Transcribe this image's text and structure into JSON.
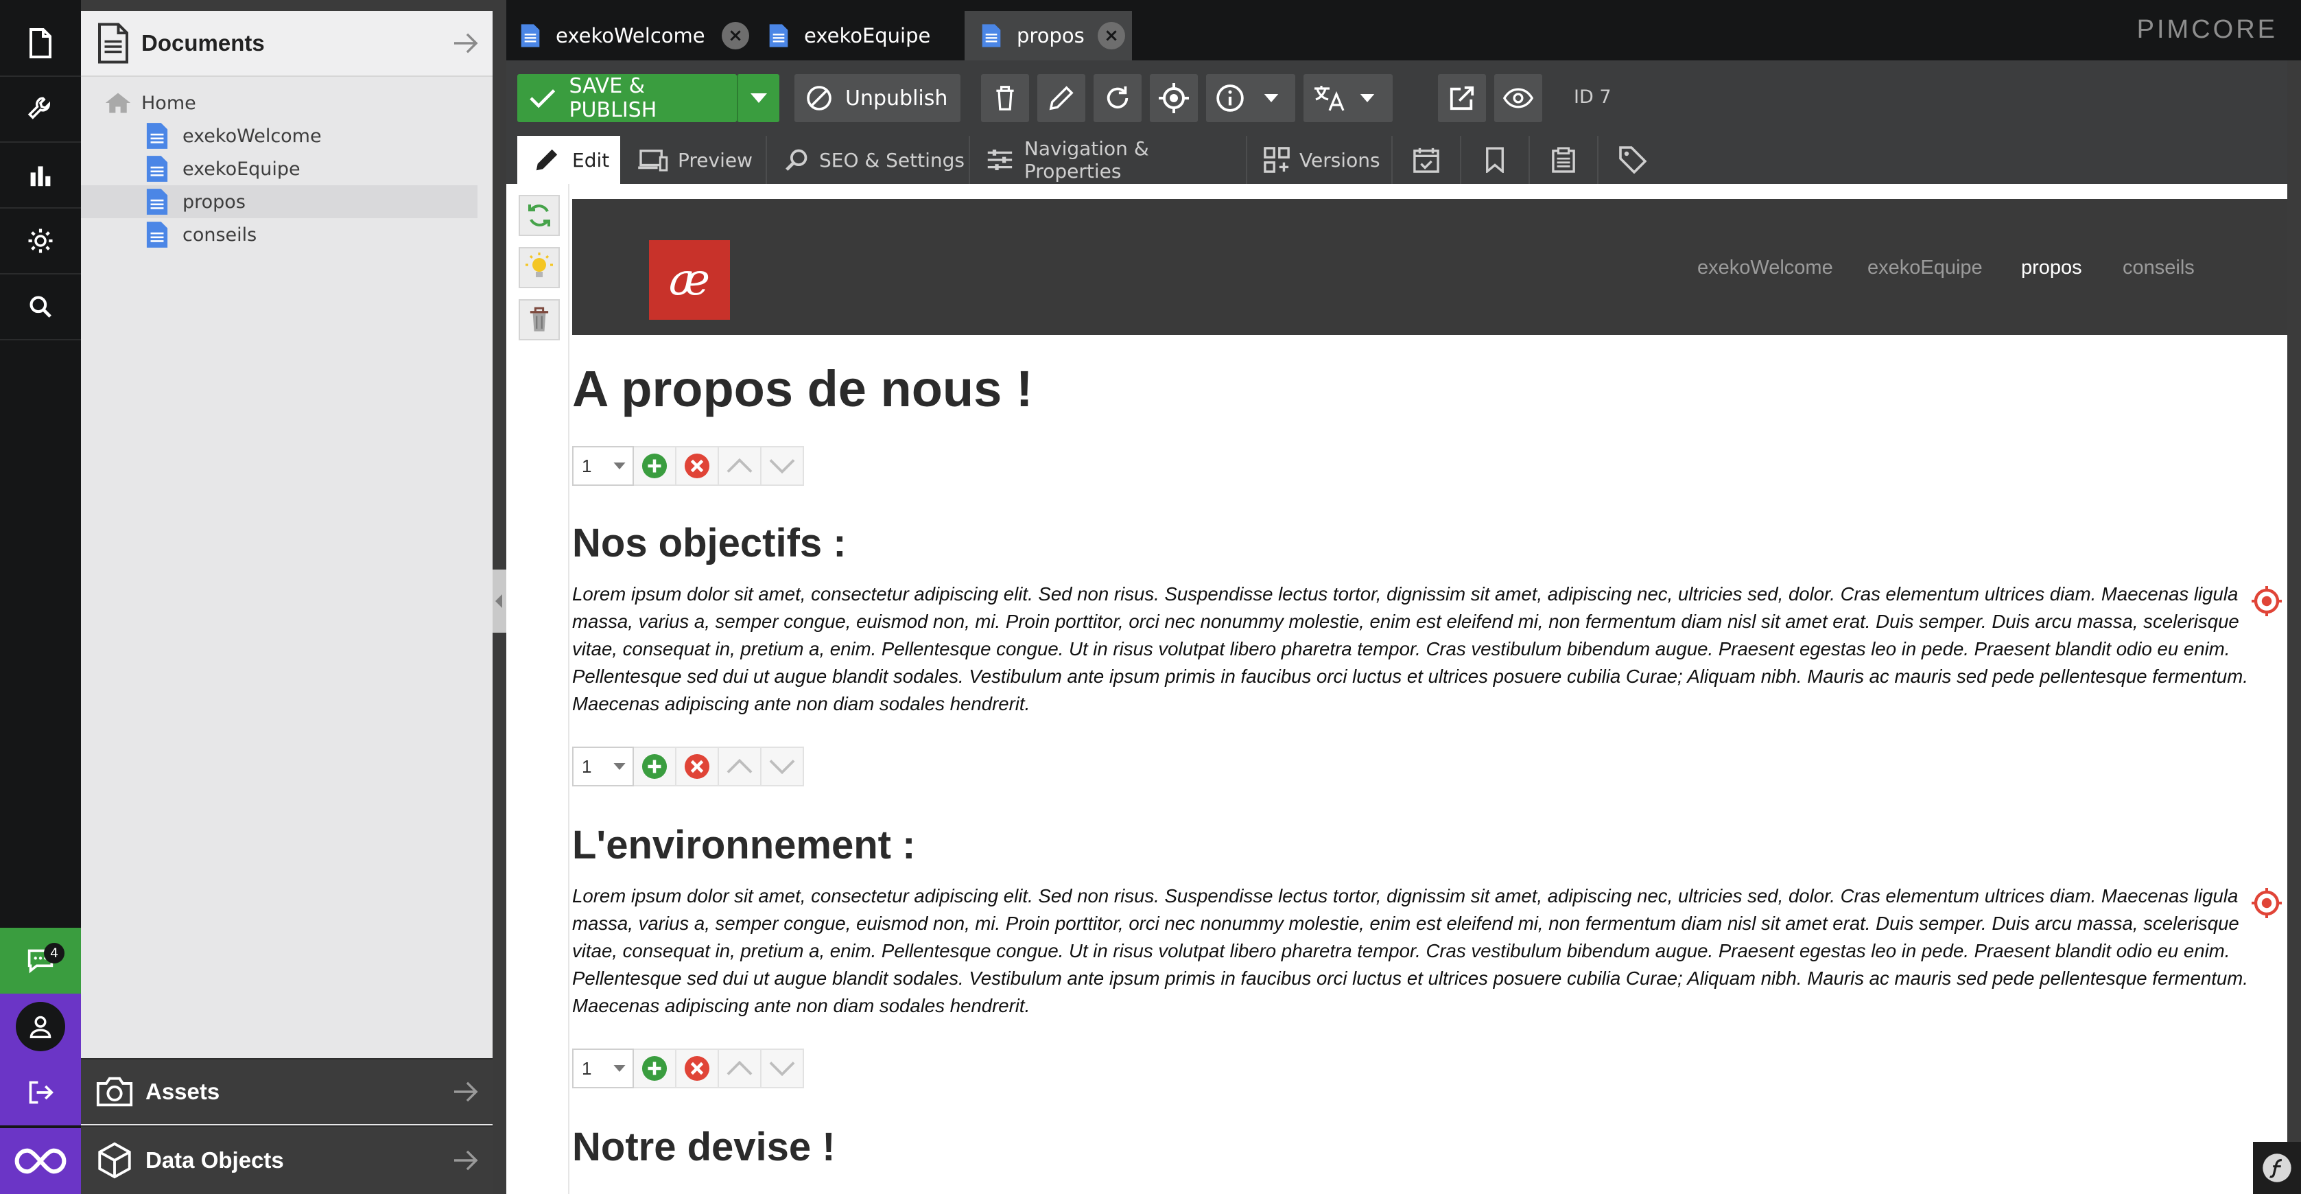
{
  "brand": "PIMCORE",
  "rail": {
    "notification_count": "4",
    "colors": {
      "notify_bg": "#3a9d3f",
      "user_bg": "#6b35c6"
    }
  },
  "tree": {
    "title": "Documents",
    "root": "Home",
    "items": [
      {
        "label": "exekoWelcome"
      },
      {
        "label": "exekoEquipe"
      },
      {
        "label": "propos"
      },
      {
        "label": "conseils"
      }
    ]
  },
  "panels": {
    "assets": "Assets",
    "data_objects": "Data Objects"
  },
  "tabs": [
    {
      "label": "exekoWelcome"
    },
    {
      "label": "exekoEquipe"
    },
    {
      "label": "propos"
    }
  ],
  "toolbar": {
    "save_publish": "SAVE & PUBLISH",
    "unpublish": "Unpublish",
    "id_label": "ID 7"
  },
  "subtabs": {
    "edit": "Edit",
    "preview": "Preview",
    "seo": "SEO & Settings",
    "navigation": "Navigation & Properties",
    "versions": "Versions"
  },
  "site": {
    "logo_text": "æ",
    "nav": [
      "exekoWelcome",
      "exekoEquipe",
      "propos",
      "conseils"
    ],
    "page_title": "A propos de nous !",
    "sections": [
      {
        "heading": "Nos objectifs :",
        "block_value": "1",
        "lines": [
          "Lorem ipsum dolor sit amet, consectetur adipiscing elit. Sed non risus. Suspendisse lectus tortor, dignissim sit amet, adipiscing nec, ultricies sed, dolor. Cras elementum ultrices diam. Maecenas ligula",
          "massa, varius a, semper congue, euismod non, mi. Proin porttitor, orci nec nonummy molestie, enim est eleifend mi, non fermentum diam nisl sit amet erat. Duis semper. Duis arcu massa, scelerisque",
          "vitae, consequat in, pretium a, enim. Pellentesque congue. Ut in risus volutpat libero pharetra tempor. Cras vestibulum bibendum augue. Praesent egestas leo in pede. Praesent blandit odio eu enim.",
          "Pellentesque sed dui ut augue blandit sodales. Vestibulum ante ipsum primis in faucibus orci luctus et ultrices posuere cubilia Curae; Aliquam nibh. Mauris ac mauris sed pede pellentesque fermentum.",
          "Maecenas adipiscing ante non diam sodales hendrerit."
        ]
      },
      {
        "heading": "L'environnement :",
        "block_value": "1",
        "lines": [
          "Lorem ipsum dolor sit amet, consectetur adipiscing elit. Sed non risus. Suspendisse lectus tortor, dignissim sit amet, adipiscing nec, ultricies sed, dolor. Cras elementum ultrices diam. Maecenas ligula",
          "massa, varius a, semper congue, euismod non, mi. Proin porttitor, orci nec nonummy molestie, enim est eleifend mi, non fermentum diam nisl sit amet erat. Duis semper. Duis arcu massa, scelerisque",
          "vitae, consequat in, pretium a, enim. Pellentesque congue. Ut in risus volutpat libero pharetra tempor. Cras vestibulum bibendum augue. Praesent egestas leo in pede. Praesent blandit odio eu enim.",
          "Pellentesque sed dui ut augue blandit sodales. Vestibulum ante ipsum primis in faucibus orci luctus et ultrices posuere cubilia Curae; Aliquam nibh. Mauris ac mauris sed pede pellentesque fermentum.",
          "Maecenas adipiscing ante non diam sodales hendrerit."
        ]
      }
    ],
    "first_block_value": "1",
    "devise_heading": "Notre devise !"
  },
  "icons": {
    "rail": [
      "file-icon",
      "wrench-icon",
      "bar-chart-icon",
      "gear-icon",
      "search-icon",
      "chat-icon",
      "user-icon",
      "logout-icon",
      "infinity-icon"
    ],
    "toolbar": [
      "check-icon",
      "ban-icon",
      "trash-icon",
      "pencil-icon",
      "reload-icon",
      "crosshair-icon",
      "info-icon",
      "translate-icon",
      "external-link-icon",
      "eye-icon"
    ],
    "block": [
      "plus-icon",
      "close-icon",
      "chevron-up-icon",
      "chevron-down-icon"
    ]
  }
}
